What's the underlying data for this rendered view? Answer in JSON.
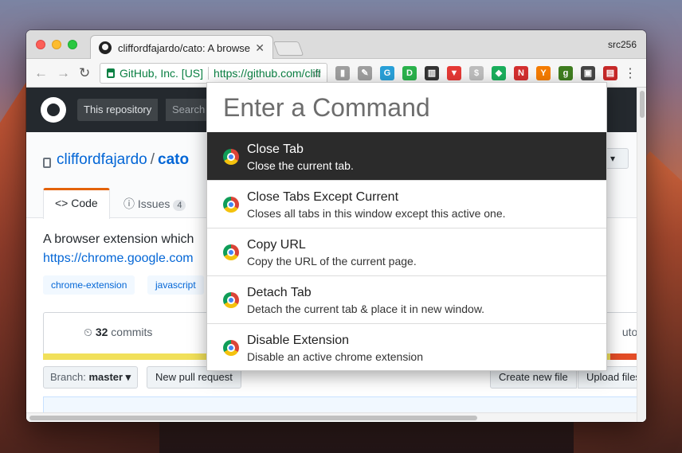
{
  "window": {
    "tab_title": "cliffordfajardo/cato: A browser",
    "tab_close": "✕",
    "profile_name": "src256"
  },
  "toolbar": {
    "back": "←",
    "forward": "→",
    "reload": "↻",
    "secure_label": "GitHub, Inc. [US]",
    "url": "https://github.com/cliffordfajardo/cato",
    "star": "☆",
    "menu": "⋮",
    "extensions": [
      {
        "name": "doc-icon",
        "glyph": "▮",
        "color": "#9e9e9e"
      },
      {
        "name": "pin-icon",
        "glyph": "✎",
        "color": "#9e9e9e"
      },
      {
        "name": "translate-icon",
        "glyph": "G",
        "color": "#29a0d8"
      },
      {
        "name": "pocket-green-icon",
        "glyph": "D",
        "color": "#2bb24c"
      },
      {
        "name": "building-icon",
        "glyph": "▥",
        "color": "#333333"
      },
      {
        "name": "red-shield-icon",
        "glyph": "▼",
        "color": "#e53935"
      },
      {
        "name": "dollar-icon",
        "glyph": "$",
        "color": "#bdbdbd"
      },
      {
        "name": "diamond-icon",
        "glyph": "◆",
        "color": "#1aae5c"
      },
      {
        "name": "red-n-icon",
        "glyph": "N",
        "color": "#d32f2f"
      },
      {
        "name": "y-icon",
        "glyph": "Y",
        "color": "#f57c00"
      },
      {
        "name": "g-icon",
        "glyph": "g",
        "color": "#3f7d20"
      },
      {
        "name": "cato-icon",
        "glyph": "▣",
        "color": "#444444"
      },
      {
        "name": "screen-icon",
        "glyph": "▤",
        "color": "#c62828"
      }
    ]
  },
  "github": {
    "scope_label": "This repository",
    "search_placeholder": "Search",
    "owner": "cliffordfajardo",
    "slash": "/",
    "repo": "cato",
    "star_button": "n ▾",
    "code_tab": "<> Code",
    "issues_tab": "ⓘ Issues",
    "issues_count": "4",
    "description": "A browser extension which",
    "homepage": "https://chrome.google.com",
    "topics": [
      "chrome-extension",
      "javascript"
    ],
    "commits_count": "32",
    "commits_label": "commits",
    "contributors_label": "utor",
    "branch_label": "Branch:",
    "branch_name": "master ▾",
    "new_pr": "New pull request",
    "create_file": "Create new file",
    "upload_files": "Upload files"
  },
  "palette": {
    "placeholder": "Enter a Command",
    "commands": [
      {
        "title": "Close Tab",
        "desc": "Close the current tab."
      },
      {
        "title": "Close Tabs Except Current",
        "desc": "Closes all tabs in this window except this active one."
      },
      {
        "title": "Copy URL",
        "desc": "Copy the URL of the current page."
      },
      {
        "title": "Detach Tab",
        "desc": "Detach the current tab & place it in new window."
      },
      {
        "title": "Disable Extension",
        "desc": "Disable an active chrome extension"
      }
    ]
  }
}
